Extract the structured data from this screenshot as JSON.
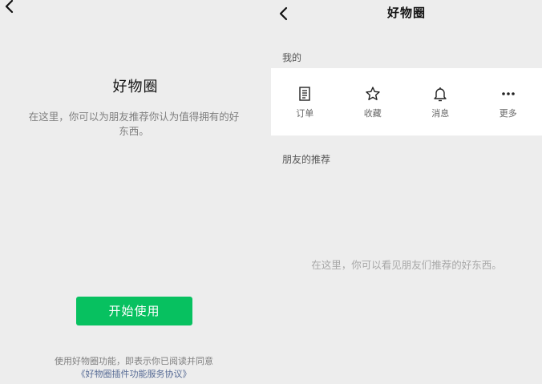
{
  "left": {
    "title": "好物圈",
    "description": "在这里，你可以为朋友推荐你认为值得拥有的好东西。",
    "start_button": "开始使用",
    "agreement_prefix": "使用好物圈功能，即表示你已阅读并同意",
    "agreement_link": "《好物圈插件功能服务协议》"
  },
  "right": {
    "title": "好物圈",
    "my_section_label": "我的",
    "my_items": [
      {
        "label": "订单",
        "icon": "order-icon"
      },
      {
        "label": "收藏",
        "icon": "star-icon"
      },
      {
        "label": "消息",
        "icon": "bell-icon"
      },
      {
        "label": "更多",
        "icon": "more-icon"
      }
    ],
    "friends_section_label": "朋友的推荐",
    "empty_message": "在这里，你可以看见朋友们推荐的好东西。"
  },
  "colors": {
    "background": "#ededed",
    "primary_green": "#07c160",
    "link_blue": "#576b95",
    "card_white": "#ffffff"
  }
}
